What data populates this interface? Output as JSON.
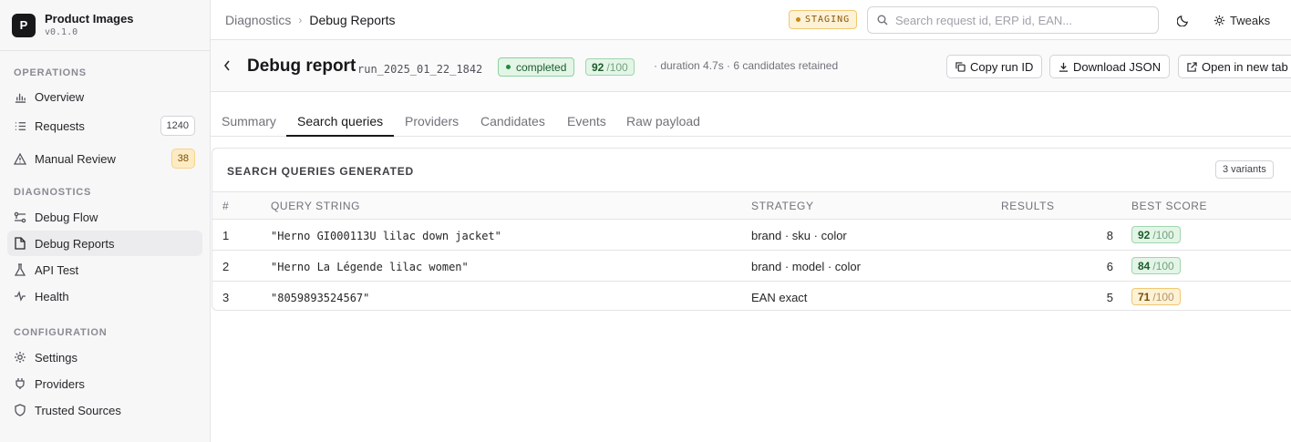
{
  "sidebar": {
    "app_name": "Product Images",
    "version": "v0.1.0",
    "logo_letter": "P",
    "sections": [
      {
        "label": "OPERATIONS",
        "items": [
          {
            "label": "Overview",
            "icon": "bar-chart-icon"
          },
          {
            "label": "Requests",
            "icon": "list-icon",
            "count": "1240"
          },
          {
            "label": "Manual Review",
            "icon": "warning-icon",
            "count": "38"
          }
        ]
      },
      {
        "label": "DIAGNOSTICS",
        "items": [
          {
            "label": "Debug Flow",
            "icon": "flow-icon"
          },
          {
            "label": "Debug Reports",
            "icon": "file-icon",
            "active": true
          },
          {
            "label": "API Test",
            "icon": "flask-icon"
          },
          {
            "label": "Health",
            "icon": "pulse-icon"
          }
        ]
      },
      {
        "label": "CONFIGURATION",
        "items": [
          {
            "label": "Settings",
            "icon": "gear-icon"
          },
          {
            "label": "Providers",
            "icon": "plug-icon"
          },
          {
            "label": "Trusted Sources",
            "icon": "shield-icon"
          }
        ]
      }
    ]
  },
  "topbar": {
    "breadcrumb": [
      "Diagnostics",
      "Debug Reports"
    ],
    "environment": "STAGING",
    "search_placeholder": "Search request id, ERP id, EAN...",
    "tweaks_label": "Tweaks"
  },
  "report": {
    "title": "Debug report",
    "run_id": "run_2025_01_22_1842",
    "status": "completed",
    "score": "92",
    "score_max": "/100",
    "meta": "· duration 4.7s · 6 candidates retained",
    "actions": {
      "copy": "Copy run ID",
      "download": "Download JSON",
      "open": "Open in new tab"
    }
  },
  "tabs": [
    "Summary",
    "Search queries",
    "Providers",
    "Candidates",
    "Events",
    "Raw payload"
  ],
  "active_tab": "Search queries",
  "queries": {
    "title": "SEARCH QUERIES GENERATED",
    "variants": "3 variants",
    "columns": [
      "#",
      "QUERY STRING",
      "STRATEGY",
      "RESULTS",
      "BEST SCORE"
    ],
    "rows": [
      {
        "n": "1",
        "query": "\"Herno GI000113U lilac down jacket\"",
        "strategy": "brand · sku · color",
        "results": "8",
        "score": "92",
        "max": "/100",
        "level": "good"
      },
      {
        "n": "2",
        "query": "\"Herno La Légende lilac women\"",
        "strategy": "brand · model · color",
        "results": "6",
        "score": "84",
        "max": "/100",
        "level": "good"
      },
      {
        "n": "3",
        "query": "\"8059893524567\"",
        "strategy": "EAN exact",
        "results": "5",
        "score": "71",
        "max": "/100",
        "level": "mid"
      }
    ]
  },
  "colors": {
    "accent_dark": "#18181b",
    "success": "#1f8a3e",
    "warning": "#c98a10"
  }
}
